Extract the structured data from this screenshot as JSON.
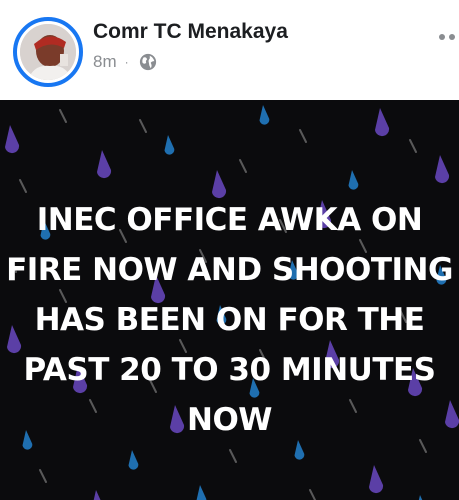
{
  "post": {
    "author": "Comr TC Menakaya",
    "timestamp": "8m",
    "separator": "·",
    "privacy_icon": "globe-icon",
    "more_icon": "more-options-icon",
    "avatar": "profile-photo",
    "text_lines": [
      "INEC OFFICE AWKA ON",
      "FIRE  NOW AND SHOOTING",
      "HAS BEEN ON FOR THE",
      "PAST 20 TO 30 MINUTES",
      "NOW"
    ],
    "background": "rain-drops-on-black"
  },
  "colors": {
    "accent": "#1877f2",
    "meta_text": "#8a8d91",
    "image_background": "#0b0b0d",
    "drop_purple": "#5b3fa6",
    "drop_blue": "#1f6fb0",
    "streak": "#9a9a9a"
  }
}
